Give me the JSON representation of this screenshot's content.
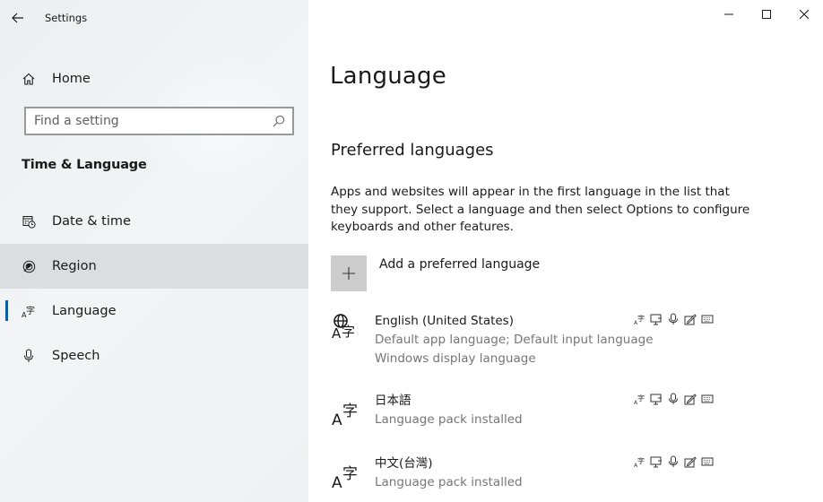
{
  "window": {
    "app_title": "Settings",
    "caption": {
      "minimize_glyph": "—",
      "maximize_glyph": "☐",
      "close_glyph": "✕"
    }
  },
  "sidebar": {
    "home_label": "Home",
    "search_placeholder": "Find a setting",
    "section_header": "Time & Language",
    "items": [
      {
        "label": "Date & time",
        "icon": "calendar-clock-icon",
        "selected": false
      },
      {
        "label": "Region",
        "icon": "globe-region-icon",
        "selected": false
      },
      {
        "label": "Language",
        "icon": "language-icon",
        "selected": true
      },
      {
        "label": "Speech",
        "icon": "microphone-icon",
        "selected": false
      }
    ],
    "accent_color": "#0063b1"
  },
  "main": {
    "page_title": "Language",
    "section_title": "Preferred languages",
    "description": "Apps and websites will appear in the first language in the list that they support. Select a language and then select Options to configure keyboards and other features.",
    "add_language_label": "Add a preferred language",
    "languages": [
      {
        "name": "English (United States)",
        "subtitle_1": "Default app language; Default input language",
        "subtitle_2": "Windows display language",
        "features": [
          "language-pack-icon",
          "display-language-icon",
          "speech-icon",
          "handwriting-icon",
          "keyboard-icon"
        ]
      },
      {
        "name": "日本語",
        "subtitle_1": "Language pack installed",
        "features": [
          "language-pack-icon",
          "display-language-icon",
          "speech-icon",
          "handwriting-icon",
          "keyboard-icon"
        ]
      },
      {
        "name": "中文(台灣)",
        "subtitle_1": "Language pack installed",
        "features": [
          "language-pack-icon",
          "display-language-icon",
          "speech-icon",
          "handwriting-icon",
          "keyboard-icon"
        ]
      }
    ]
  }
}
